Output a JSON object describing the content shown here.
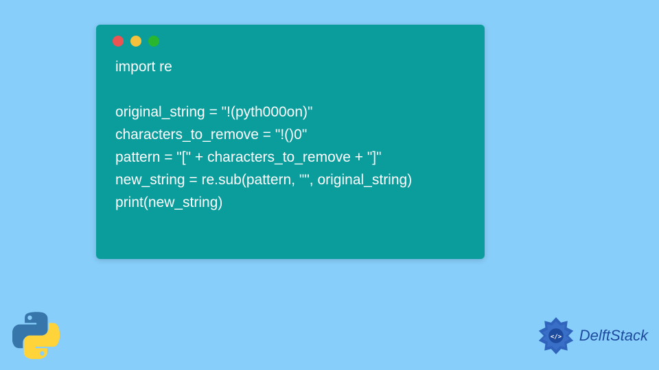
{
  "code": {
    "line1": "import re",
    "blank": "",
    "line2": "original_string = \"!(pyth000on)\"",
    "line3": "characters_to_remove = \"!()0\"",
    "line4": "pattern = \"[\" + characters_to_remove + \"]\"",
    "line5": "new_string = re.sub(pattern, \"\", original_string)",
    "line6": "print(new_string)"
  },
  "brand": {
    "name": "DelftStack"
  }
}
